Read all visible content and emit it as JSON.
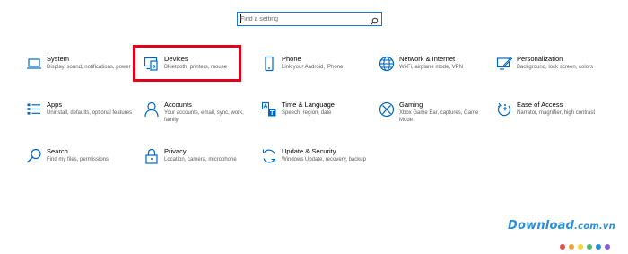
{
  "search": {
    "placeholder": "Find a setting"
  },
  "accent_color": "#0067c0",
  "highlight_color": "#e3001b",
  "tiles": [
    {
      "icon": "laptop-icon",
      "title": "System",
      "desc": "Display, sound, notifications, power"
    },
    {
      "icon": "devices-icon",
      "title": "Devices",
      "desc": "Bluetooth, printers, mouse",
      "highlighted": true
    },
    {
      "icon": "phone-icon",
      "title": "Phone",
      "desc": "Link your Android, iPhone"
    },
    {
      "icon": "globe-icon",
      "title": "Network & Internet",
      "desc": "Wi-Fi, airplane mode, VPN"
    },
    {
      "icon": "personalization-icon",
      "title": "Personalization",
      "desc": "Background, lock screen, colors"
    },
    {
      "icon": "apps-icon",
      "title": "Apps",
      "desc": "Uninstall, defaults, optional features"
    },
    {
      "icon": "person-icon",
      "title": "Accounts",
      "desc": "Your accounts, email, sync, work, family"
    },
    {
      "icon": "time-language-icon",
      "title": "Time & Language",
      "desc": "Speech, region, date"
    },
    {
      "icon": "xbox-icon",
      "title": "Gaming",
      "desc": "Xbox Game Bar, captures, Game Mode"
    },
    {
      "icon": "ease-of-access-icon",
      "title": "Ease of Access",
      "desc": "Narrator, magnifier, high contrast"
    },
    {
      "icon": "search-icon",
      "title": "Search",
      "desc": "Find my files, permissions"
    },
    {
      "icon": "lock-icon",
      "title": "Privacy",
      "desc": "Location, camera, microphone"
    },
    {
      "icon": "sync-icon",
      "title": "Update & Security",
      "desc": "Windows Update, recovery, backup"
    }
  ],
  "watermark": {
    "brand": "Download",
    "tld": ".com.vn",
    "dot_colors": [
      "#e94d4d",
      "#f3a33b",
      "#f4d23a",
      "#4cb86a",
      "#2a8fd8",
      "#8a5bd6"
    ]
  }
}
